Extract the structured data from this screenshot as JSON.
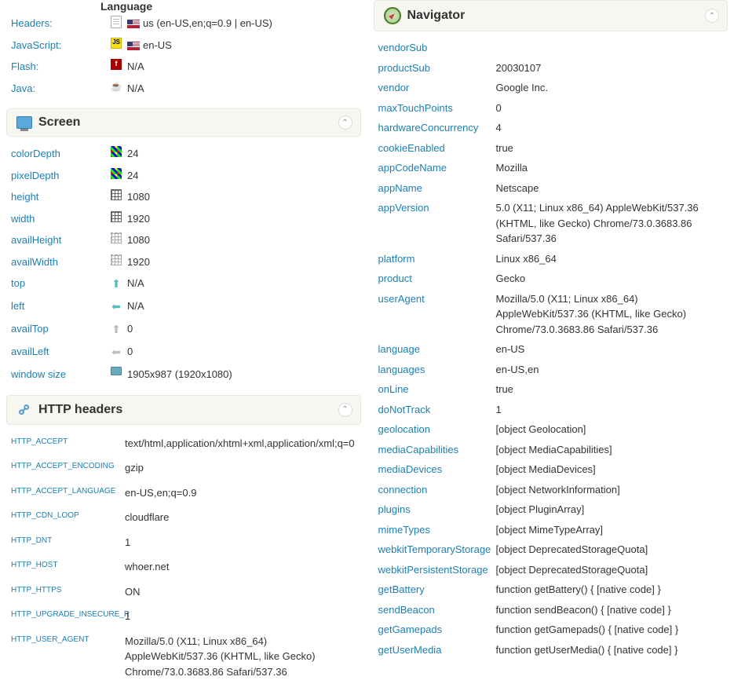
{
  "language": {
    "title": "Language",
    "rows": [
      {
        "label": "Headers:",
        "icon": "doc",
        "value": "us (en-US,en;q=0.9 | en-US)",
        "flag": true
      },
      {
        "label": "JavaScript:",
        "icon": "js",
        "value": "en-US",
        "flag": true
      },
      {
        "label": "Flash:",
        "icon": "flash",
        "value": "N/A",
        "flag": false
      },
      {
        "label": "Java:",
        "icon": "java",
        "value": "N/A",
        "flag": false
      }
    ]
  },
  "screen": {
    "title": "Screen",
    "rows": [
      {
        "label": "colorDepth",
        "icon": "color-grid",
        "value": "24"
      },
      {
        "label": "pixelDepth",
        "icon": "color-grid",
        "value": "24"
      },
      {
        "label": "height",
        "icon": "grid",
        "value": "1080"
      },
      {
        "label": "width",
        "icon": "grid",
        "value": "1920"
      },
      {
        "label": "availHeight",
        "icon": "grid-dash",
        "value": "1080"
      },
      {
        "label": "availWidth",
        "icon": "grid-dash",
        "value": "1920"
      },
      {
        "label": "top",
        "icon": "arrow-up",
        "value": "N/A"
      },
      {
        "label": "left",
        "icon": "arrow-left",
        "value": "N/A"
      },
      {
        "label": "availTop",
        "icon": "arrow-up-gray",
        "value": "0"
      },
      {
        "label": "availLeft",
        "icon": "arrow-left-gray",
        "value": "0"
      },
      {
        "label": "window size",
        "icon": "small-monitor",
        "value": "1905x987 (1920x1080)"
      }
    ]
  },
  "http": {
    "title": "HTTP headers",
    "rows": [
      {
        "label": "HTTP_ACCEPT",
        "value": "text/html,application/xhtml+xml,application/xml;q=0"
      },
      {
        "label": "HTTP_ACCEPT_ENCODING",
        "value": "gzip"
      },
      {
        "label": "HTTP_ACCEPT_LANGUAGE",
        "value": "en-US,en;q=0.9"
      },
      {
        "label": "HTTP_CDN_LOOP",
        "value": "cloudflare"
      },
      {
        "label": "HTTP_DNT",
        "value": "1"
      },
      {
        "label": "HTTP_HOST",
        "value": "whoer.net"
      },
      {
        "label": "HTTP_HTTPS",
        "value": "ON"
      },
      {
        "label": "HTTP_UPGRADE_INSECURE_R",
        "value": "1"
      },
      {
        "label": "HTTP_USER_AGENT",
        "value": "Mozilla/5.0 (X11; Linux x86_64) AppleWebKit/537.36 (KHTML, like Gecko) Chrome/73.0.3683.86 Safari/537.36"
      }
    ]
  },
  "navigator": {
    "title": "Navigator",
    "rows": [
      {
        "label": "vendorSub",
        "value": ""
      },
      {
        "label": "productSub",
        "value": "20030107"
      },
      {
        "label": "vendor",
        "value": "Google Inc."
      },
      {
        "label": "maxTouchPoints",
        "value": "0"
      },
      {
        "label": "hardwareConcurrency",
        "value": "4"
      },
      {
        "label": "cookieEnabled",
        "value": "true"
      },
      {
        "label": "appCodeName",
        "value": "Mozilla"
      },
      {
        "label": "appName",
        "value": "Netscape"
      },
      {
        "label": "appVersion",
        "value": "5.0 (X11; Linux x86_64) AppleWebKit/537.36 (KHTML, like Gecko) Chrome/73.0.3683.86 Safari/537.36"
      },
      {
        "label": "platform",
        "value": "Linux x86_64"
      },
      {
        "label": "product",
        "value": "Gecko"
      },
      {
        "label": "userAgent",
        "value": "Mozilla/5.0 (X11; Linux x86_64) AppleWebKit/537.36 (KHTML, like Gecko) Chrome/73.0.3683.86 Safari/537.36"
      },
      {
        "label": "language",
        "value": "en-US"
      },
      {
        "label": "languages",
        "value": "en-US,en"
      },
      {
        "label": "onLine",
        "value": "true"
      },
      {
        "label": "doNotTrack",
        "value": "1"
      },
      {
        "label": "geolocation",
        "value": "[object Geolocation]"
      },
      {
        "label": "mediaCapabilities",
        "value": "[object MediaCapabilities]"
      },
      {
        "label": "mediaDevices",
        "value": "[object MediaDevices]"
      },
      {
        "label": "connection",
        "value": "[object NetworkInformation]"
      },
      {
        "label": "plugins",
        "value": "[object PluginArray]"
      },
      {
        "label": "mimeTypes",
        "value": "[object MimeTypeArray]"
      },
      {
        "label": "webkitTemporaryStorage",
        "value": "[object DeprecatedStorageQuota]"
      },
      {
        "label": "webkitPersistentStorage",
        "value": "[object DeprecatedStorageQuota]"
      },
      {
        "label": "getBattery",
        "value": "function getBattery() { [native code] }"
      },
      {
        "label": "sendBeacon",
        "value": "function sendBeacon() { [native code] }"
      },
      {
        "label": "getGamepads",
        "value": "function getGamepads() { [native code] }"
      },
      {
        "label": "getUserMedia",
        "value": "function getUserMedia() { [native code] }"
      }
    ]
  }
}
